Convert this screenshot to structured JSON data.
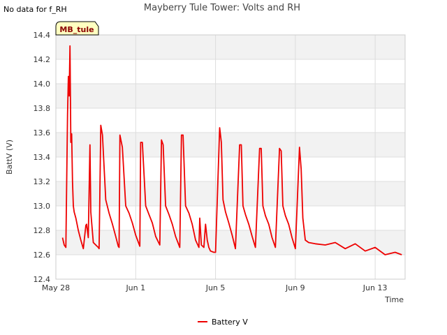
{
  "note": "No data for f_RH",
  "chart_data": {
    "type": "line",
    "title": "Mayberry Tule Tower: Volts and RH",
    "xlabel": "Time",
    "ylabel": "BattV (V)",
    "badge": "MB_tule",
    "ylim": [
      12.4,
      14.4
    ],
    "yticks": [
      "12.4",
      "12.6",
      "12.8",
      "13.0",
      "13.2",
      "13.4",
      "13.6",
      "13.8",
      "14.0",
      "14.2",
      "14.4"
    ],
    "xlim": [
      "2024-05-28",
      "2024-06-14 12:00"
    ],
    "xticks": [
      {
        "value": "2024-05-28",
        "label": "May 28"
      },
      {
        "value": "2024-06-01",
        "label": "Jun 1"
      },
      {
        "value": "2024-06-05",
        "label": "Jun 5"
      },
      {
        "value": "2024-06-09",
        "label": "Jun 9"
      },
      {
        "value": "2024-06-13",
        "label": "Jun 13"
      }
    ],
    "grid": true,
    "alternating_bands": true,
    "legend_position": "bottom-center",
    "series": [
      {
        "name": "Battery V",
        "color": "#ee0000",
        "x": [
          "2024-05-28 08:00",
          "2024-05-28 10:00",
          "2024-05-28 12:00",
          "2024-05-28 14:00",
          "2024-05-28 15:00",
          "2024-05-28 16:00",
          "2024-05-28 17:00",
          "2024-05-28 18:00",
          "2024-05-28 19:00",
          "2024-05-28 20:00",
          "2024-05-28 21:00",
          "2024-05-28 22:00",
          "2024-05-29 00:00",
          "2024-05-29 03:00",
          "2024-05-29 06:00",
          "2024-05-29 09:00",
          "2024-05-29 12:00",
          "2024-05-29 13:00",
          "2024-05-29 15:00",
          "2024-05-29 17:00",
          "2024-05-29 18:00",
          "2024-05-29 21:00",
          "2024-05-30 00:00",
          "2024-05-30 03:00",
          "2024-05-30 04:00",
          "2024-05-30 06:00",
          "2024-05-30 08:00",
          "2024-05-30 12:00",
          "2024-05-30 16:00",
          "2024-05-30 20:00",
          "2024-05-31 00:00",
          "2024-05-31 03:00",
          "2024-05-31 04:00",
          "2024-05-31 05:00",
          "2024-05-31 08:00",
          "2024-05-31 12:00",
          "2024-05-31 16:00",
          "2024-05-31 20:00",
          "2024-06-01 00:00",
          "2024-06-01 05:00",
          "2024-06-01 06:00",
          "2024-06-01 08:00",
          "2024-06-01 12:00",
          "2024-06-01 16:00",
          "2024-06-01 20:00",
          "2024-06-02 00:00",
          "2024-06-02 05:00",
          "2024-06-02 07:00",
          "2024-06-02 09:00",
          "2024-06-02 12:00",
          "2024-06-02 16:00",
          "2024-06-02 20:00",
          "2024-06-03 00:00",
          "2024-06-03 05:00",
          "2024-06-03 07:00",
          "2024-06-03 09:00",
          "2024-06-03 12:00",
          "2024-06-03 16:00",
          "2024-06-03 20:00",
          "2024-06-04 00:00",
          "2024-06-04 04:00",
          "2024-06-04 05:00",
          "2024-06-04 07:00",
          "2024-06-04 10:00",
          "2024-06-04 12:00",
          "2024-06-04 14:00",
          "2024-06-04 16:00",
          "2024-06-04 18:00",
          "2024-06-04 22:00",
          "2024-06-05 00:00",
          "2024-06-05 05:00",
          "2024-06-05 07:00",
          "2024-06-05 09:00",
          "2024-06-05 12:00",
          "2024-06-05 16:00",
          "2024-06-05 20:00",
          "2024-06-06 00:00",
          "2024-06-06 05:00",
          "2024-06-06 07:00",
          "2024-06-06 09:00",
          "2024-06-06 12:00",
          "2024-06-06 16:00",
          "2024-06-06 20:00",
          "2024-06-07 00:00",
          "2024-06-07 05:00",
          "2024-06-07 07:00",
          "2024-06-07 09:00",
          "2024-06-07 12:00",
          "2024-06-07 16:00",
          "2024-06-07 20:00",
          "2024-06-08 00:00",
          "2024-06-08 05:00",
          "2024-06-08 07:00",
          "2024-06-08 09:00",
          "2024-06-08 12:00",
          "2024-06-08 16:00",
          "2024-06-08 20:00",
          "2024-06-09 00:00",
          "2024-06-09 05:00",
          "2024-06-09 07:00",
          "2024-06-09 09:00",
          "2024-06-09 12:00",
          "2024-06-09 16:00",
          "2024-06-10 00:00",
          "2024-06-10 12:00",
          "2024-06-11 00:00",
          "2024-06-11 12:00",
          "2024-06-12 00:00",
          "2024-06-12 12:00",
          "2024-06-13 00:00",
          "2024-06-13 12:00",
          "2024-06-14 00:00",
          "2024-06-14 08:00"
        ],
        "values": [
          12.74,
          12.68,
          12.66,
          13.75,
          14.06,
          13.9,
          14.31,
          13.52,
          13.59,
          13.2,
          13.0,
          12.95,
          12.9,
          12.8,
          12.72,
          12.65,
          12.84,
          12.85,
          12.74,
          13.5,
          12.95,
          12.7,
          12.68,
          12.66,
          12.65,
          13.66,
          13.58,
          13.05,
          12.94,
          12.85,
          12.75,
          12.67,
          12.66,
          13.58,
          13.48,
          13.0,
          12.94,
          12.86,
          12.76,
          12.67,
          13.52,
          13.52,
          13.0,
          12.93,
          12.86,
          12.75,
          12.68,
          13.54,
          13.5,
          13.0,
          12.93,
          12.85,
          12.75,
          12.66,
          13.58,
          13.58,
          13.0,
          12.94,
          12.85,
          12.72,
          12.66,
          12.9,
          12.68,
          12.66,
          12.85,
          12.72,
          12.66,
          12.63,
          12.62,
          12.62,
          13.64,
          13.52,
          13.05,
          12.95,
          12.86,
          12.76,
          12.65,
          13.5,
          13.5,
          13.0,
          12.93,
          12.85,
          12.75,
          12.66,
          13.47,
          13.47,
          13.0,
          12.92,
          12.85,
          12.74,
          12.66,
          13.47,
          13.45,
          13.0,
          12.92,
          12.85,
          12.74,
          12.65,
          13.48,
          13.3,
          12.9,
          12.72,
          12.7,
          12.69,
          12.68,
          12.7,
          12.65,
          12.69,
          12.63,
          12.66,
          12.6,
          12.62,
          12.6
        ]
      }
    ]
  }
}
